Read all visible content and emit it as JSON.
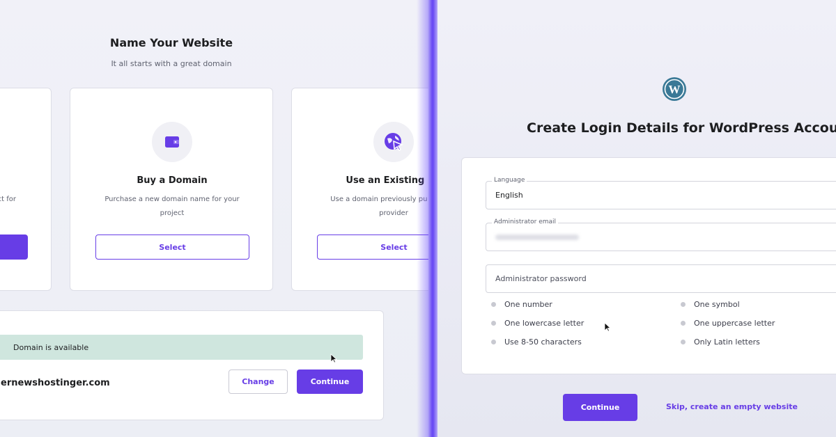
{
  "colors": {
    "accent": "#673de6",
    "available_bg": "#cfe6de",
    "divider": "#6a4cf4"
  },
  "left": {
    "title": "Name Your Website",
    "subtitle": "It all starts with a great domain",
    "cards": [
      {
        "heading": "",
        "description": "ject for",
        "button": "",
        "icon": "none"
      },
      {
        "heading": "Buy a Domain",
        "description": "Purchase a new domain name for your project",
        "button": "Select",
        "icon": "wallet-icon"
      },
      {
        "heading": "Use an Existing Do",
        "description": "Use a domain previously pu another provider",
        "button": "Select",
        "icon": "globe-cursor-icon"
      }
    ],
    "domain_panel": {
      "status": "Domain is available",
      "domain": "ernewshostinger.com",
      "change_label": "Change",
      "continue_label": "Continue"
    }
  },
  "right": {
    "logo": "wordpress-logo-icon",
    "title": "Create Login Details for WordPress Account",
    "form": {
      "language_label": "Language",
      "language_value": "English",
      "email_label": "Administrator email",
      "password_placeholder": "Administrator password",
      "requirements_left": [
        "One number",
        "One lowercase letter",
        "Use 8-50 characters"
      ],
      "requirements_right": [
        "One symbol",
        "One uppercase letter",
        "Only Latin letters"
      ]
    },
    "continue_label": "Continue",
    "skip_label": "Skip, create an empty website"
  }
}
